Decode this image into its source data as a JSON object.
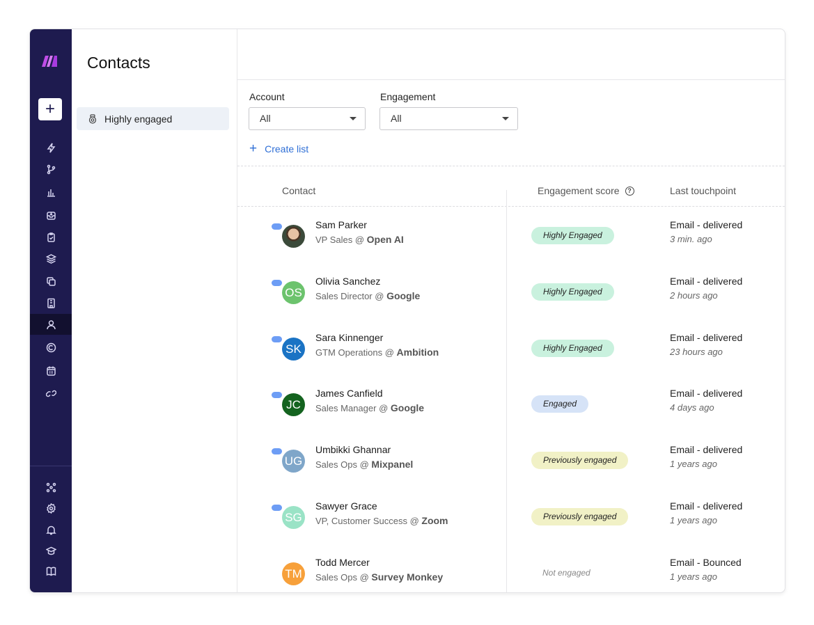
{
  "page": {
    "title": "Contacts"
  },
  "nav": {
    "items": [
      {
        "label": "Highly engaged",
        "icon": "badge-icon"
      }
    ]
  },
  "filters": {
    "account": {
      "label": "Account",
      "value": "All"
    },
    "engagement": {
      "label": "Engagement",
      "value": "All"
    },
    "create_list": "Create list"
  },
  "table": {
    "headers": {
      "contact": "Contact",
      "engagement": "Engagement score",
      "touchpoint": "Last touchpoint"
    },
    "rows": [
      {
        "name": "Sam Parker",
        "title": "VP Sales",
        "company": "Open AI",
        "initials": "",
        "avatar_color": "#3b4a3a",
        "badge": "Highly Engaged",
        "badge_color": "#c9f1de",
        "touch": "Email - delivered",
        "time": "3 min. ago"
      },
      {
        "name": "Olivia Sanchez",
        "title": "Sales Director",
        "company": "Google",
        "initials": "OS",
        "avatar_color": "#6cc36d",
        "badge": "Highly Engaged",
        "badge_color": "#c9f1de",
        "touch": "Email - delivered",
        "time": "2 hours ago"
      },
      {
        "name": "Sara Kinnenger",
        "title": "GTM Operations",
        "company": "Ambition",
        "initials": "SK",
        "avatar_color": "#1a73c4",
        "badge": "Highly Engaged",
        "badge_color": "#c9f1de",
        "touch": "Email - delivered",
        "time": "23 hours ago"
      },
      {
        "name": "James Canfield",
        "title": "Sales Manager",
        "company": "Google",
        "initials": "JC",
        "avatar_color": "#14631f",
        "badge": "Engaged",
        "badge_color": "#d6e3f7",
        "touch": "Email - delivered",
        "time": "4 days ago"
      },
      {
        "name": "Umbikki Ghannar",
        "title": "Sales Ops",
        "company": "Mixpanel",
        "initials": "UG",
        "avatar_color": "#7fa6c9",
        "badge": "Previously engaged",
        "badge_color": "#f1f1c6",
        "touch": "Email - delivered",
        "time": "1 years ago"
      },
      {
        "name": "Sawyer Grace",
        "title": "VP, Customer Success",
        "company": "Zoom",
        "initials": "SG",
        "avatar_color": "#9ae3c6",
        "badge": "Previously engaged",
        "badge_color": "#f1f1c6",
        "touch": "Email - delivered",
        "time": "1 years ago"
      },
      {
        "name": "Todd Mercer",
        "title": "Sales Ops",
        "company": "Survey Monkey",
        "initials": "TM",
        "avatar_color": "#f7a03a",
        "badge": "Not engaged",
        "badge_color": "",
        "touch": "Email - Bounced",
        "time": "1 years ago"
      }
    ]
  }
}
